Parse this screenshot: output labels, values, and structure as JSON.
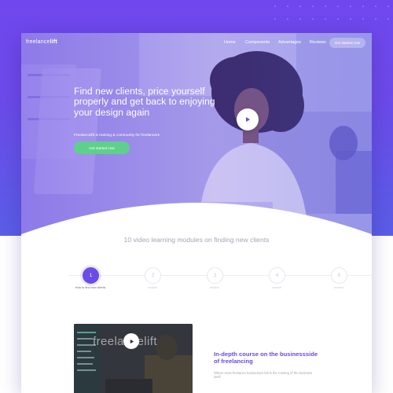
{
  "nav": {
    "logo_prefix": "freelance",
    "logo_suffix": "lift",
    "links": [
      "Home",
      "Components",
      "Advantages",
      "Reviews"
    ],
    "cta": "Get started now"
  },
  "hero": {
    "title": "Find new clients, price yourself properly and get back to enjoying your design again",
    "subtitle": "Freelancelift is training & community for freelancers",
    "cta": "Get started now"
  },
  "modules": {
    "title": "10 video learning modules on finding new clients",
    "steps": [
      {
        "number": "1",
        "label": "How to find new clients"
      },
      {
        "number": "2",
        "label": "module"
      },
      {
        "number": "3",
        "label": "module"
      },
      {
        "number": "4",
        "label": "module"
      },
      {
        "number": "5",
        "label": "module"
      }
    ],
    "active_step": 1
  },
  "course": {
    "video_wordmark": "freelancelift",
    "title": "In-depth course on the businessside of freelancing",
    "text": "Where most freelance businesses fail is the running of the business itself"
  },
  "colors": {
    "brand_purple": "#6b4ce6",
    "cta_green": "#5fd08c",
    "muted_text": "#a4a6b4"
  },
  "icons": {
    "hero_play": "play-icon",
    "video_play": "play-icon"
  }
}
